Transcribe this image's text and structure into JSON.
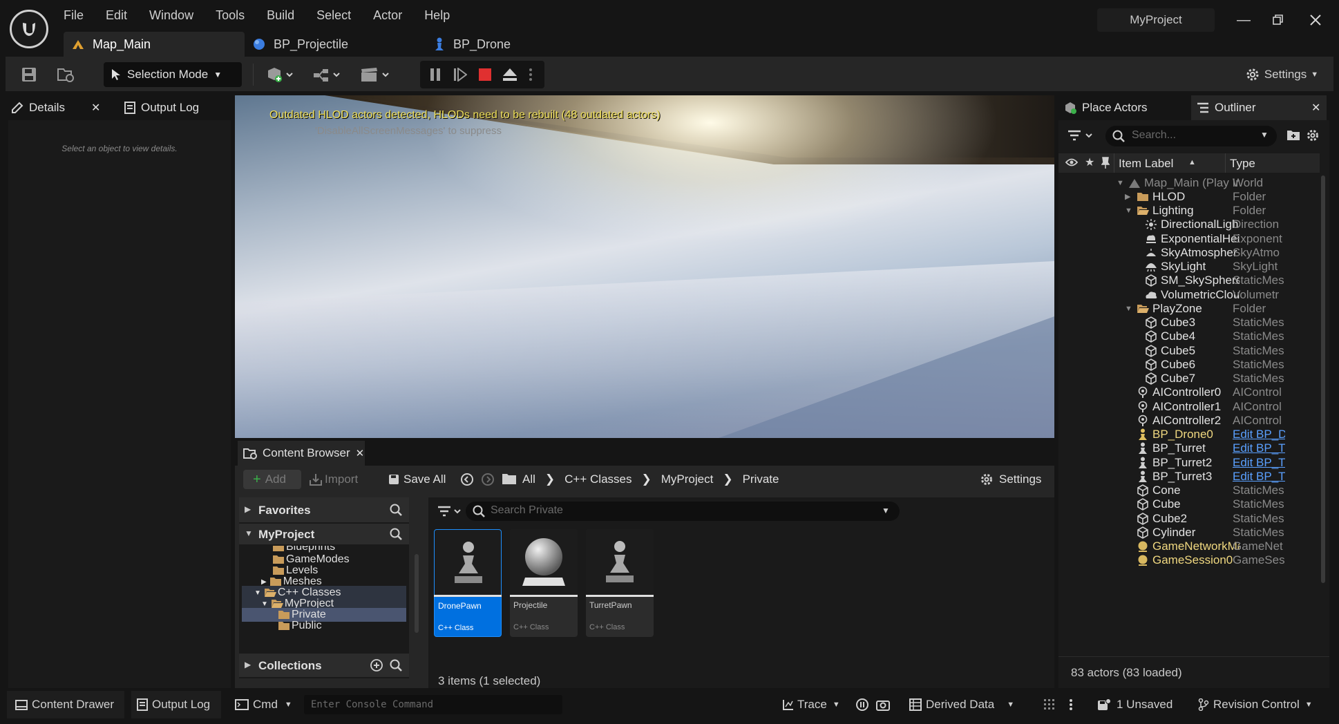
{
  "menu": [
    "File",
    "Edit",
    "Window",
    "Tools",
    "Build",
    "Select",
    "Actor",
    "Help"
  ],
  "tabs": [
    {
      "label": "Map_Main",
      "active": true
    },
    {
      "label": "BP_Projectile",
      "active": false
    },
    {
      "label": "BP_Drone",
      "active": false
    }
  ],
  "project_name": "MyProject",
  "toolbar": {
    "selection_mode": "Selection Mode",
    "settings": "Settings"
  },
  "details": {
    "tab_details": "Details",
    "tab_output_log": "Output Log",
    "empty_message": "Select an object to view details."
  },
  "viewport": {
    "warning": "Outdated HLOD actors detected, HLODs need to be rebuilt (48 outdated actors)",
    "suppress_hint": "'DisableAllScreenMessages' to suppress"
  },
  "right_panel": {
    "tab_place_actors": "Place Actors",
    "tab_outliner": "Outliner",
    "search_placeholder": "Search...",
    "col_item_label": "Item Label",
    "col_type": "Type",
    "footer": "83 actors (83 loaded)",
    "rows": [
      {
        "label": "Map_Main (Play In",
        "type": "World"
      },
      {
        "label": "HLOD",
        "type": "Folder"
      },
      {
        "label": "Lighting",
        "type": "Folder"
      },
      {
        "label": "DirectionalLigh",
        "type": "Direction"
      },
      {
        "label": "ExponentialHei",
        "type": "Exponent"
      },
      {
        "label": "SkyAtmospher",
        "type": "SkyAtmo"
      },
      {
        "label": "SkyLight",
        "type": "SkyLight"
      },
      {
        "label": "SM_SkySphere",
        "type": "StaticMes"
      },
      {
        "label": "VolumetricClou",
        "type": "Volumetr"
      },
      {
        "label": "PlayZone",
        "type": "Folder"
      },
      {
        "label": "Cube3",
        "type": "StaticMes"
      },
      {
        "label": "Cube4",
        "type": "StaticMes"
      },
      {
        "label": "Cube5",
        "type": "StaticMes"
      },
      {
        "label": "Cube6",
        "type": "StaticMes"
      },
      {
        "label": "Cube7",
        "type": "StaticMes"
      },
      {
        "label": "AIController0",
        "type": "AIControl"
      },
      {
        "label": "AIController1",
        "type": "AIControl"
      },
      {
        "label": "AIController2",
        "type": "AIControl"
      },
      {
        "label": "BP_Drone0",
        "type": "Edit BP_D"
      },
      {
        "label": "BP_Turret",
        "type": "Edit BP_T"
      },
      {
        "label": "BP_Turret2",
        "type": "Edit BP_T"
      },
      {
        "label": "BP_Turret3",
        "type": "Edit BP_T"
      },
      {
        "label": "Cone",
        "type": "StaticMes"
      },
      {
        "label": "Cube",
        "type": "StaticMes"
      },
      {
        "label": "Cube2",
        "type": "StaticMes"
      },
      {
        "label": "Cylinder",
        "type": "StaticMes"
      },
      {
        "label": "GameNetworkMa",
        "type": "GameNet"
      },
      {
        "label": "GameSession0",
        "type": "GameSes"
      }
    ]
  },
  "content_browser": {
    "title": "Content Browser",
    "add": "Add",
    "import": "Import",
    "save_all": "Save All",
    "breadcrumb": [
      "All",
      "C++ Classes",
      "MyProject",
      "Private"
    ],
    "settings": "Settings",
    "favorites": "Favorites",
    "project": "MyProject",
    "collections": "Collections",
    "search_placeholder": "Search Private",
    "tree": [
      "Blueprints",
      "GameModes",
      "Levels",
      "Meshes",
      "C++ Classes",
      "MyProject",
      "Private",
      "Public"
    ],
    "items": [
      {
        "name": "DronePawn",
        "type": "C++ Class"
      },
      {
        "name": "Projectile",
        "type": "C++ Class"
      },
      {
        "name": "TurretPawn",
        "type": "C++ Class"
      }
    ],
    "status": "3 items (1 selected)"
  },
  "statusbar": {
    "content_drawer": "Content Drawer",
    "output_log": "Output Log",
    "cmd": "Cmd",
    "console_placeholder": "Enter Console Command",
    "trace": "Trace",
    "derived_data": "Derived Data",
    "unsaved": "1 Unsaved",
    "revision_control": "Revision Control"
  },
  "colors": {
    "accent_blue": "#0070e0",
    "warning_yellow": "#f0e05a",
    "folder": "#c89b5a",
    "stop_red": "#e03030"
  }
}
